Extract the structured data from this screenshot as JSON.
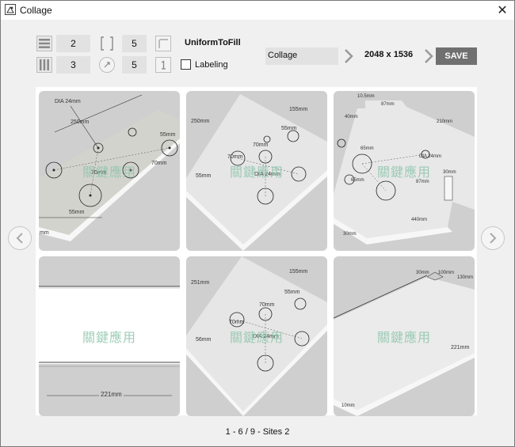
{
  "window": {
    "title": "Collage",
    "close_glyph": "✕"
  },
  "toolbar": {
    "rows_value": "2",
    "cols_value": "3",
    "spacing_value": "5",
    "radius_value": "5",
    "fit_mode": "UniformToFill",
    "labeling_label": "Labeling",
    "labeling_checked": false,
    "layout_mode": "Collage",
    "output_size": "2048 x 1536",
    "save_label": "SAVE"
  },
  "grid": {
    "watermark": "關鍵應用",
    "images": [
      {
        "labels": [
          "DIA 24mm",
          "250mm",
          "55mm",
          "70mm",
          "70mm",
          "55mm",
          "mm"
        ]
      },
      {
        "labels": [
          "250mm",
          "155mm",
          "55mm",
          "70mm",
          "70mm",
          "DIA 24mm",
          "55mm"
        ]
      },
      {
        "labels": [
          "10.5mm",
          "87mm",
          "40mm",
          "210mm",
          "65mm",
          "DIA 24mm",
          "65mm",
          "87mm",
          "30mm",
          "440mm",
          "30mm"
        ]
      },
      {
        "labels": [
          "221mm"
        ]
      },
      {
        "labels": [
          "251mm",
          "155mm",
          "55mm",
          "70mm",
          "70mm",
          "DIA 24mm",
          "56mm"
        ]
      },
      {
        "labels": [
          "30mm",
          "100mm",
          "130mm",
          "221mm",
          "10mm"
        ]
      }
    ]
  },
  "pager": {
    "status": "1 - 6 / 9 - Sites 2",
    "prev_icon": "chevron-left-icon",
    "next_icon": "chevron-right-icon"
  }
}
